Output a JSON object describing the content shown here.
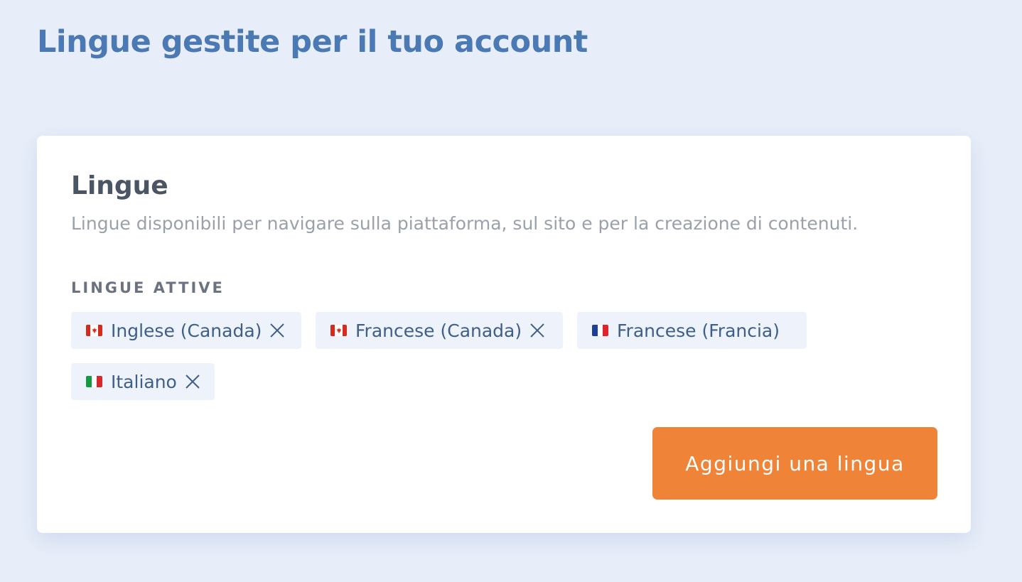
{
  "header": {
    "title": "Lingue gestite per il tuo account"
  },
  "card": {
    "title": "Lingue",
    "description": "Lingue disponibili per navigare sulla piattaforma, sul sito e per la creazione di contenuti.",
    "section_label": "LINGUE ATTIVE",
    "languages": [
      {
        "label": "Inglese (Canada)",
        "flag": "canada-flag-icon",
        "removable": true
      },
      {
        "label": "Francese (Canada)",
        "flag": "canada-flag-icon",
        "removable": true
      },
      {
        "label": "Francese (Francia)",
        "flag": "france-flag-icon",
        "removable": false
      },
      {
        "label": "Italiano",
        "flag": "italy-flag-icon",
        "removable": true
      }
    ],
    "add_button_label": "Aggiungi una lingua"
  },
  "colors": {
    "background": "#e8eef9",
    "title": "#4a79b3",
    "tag_background": "#eef2fa",
    "tag_text": "#3f5f86",
    "button": "#ef8438"
  }
}
